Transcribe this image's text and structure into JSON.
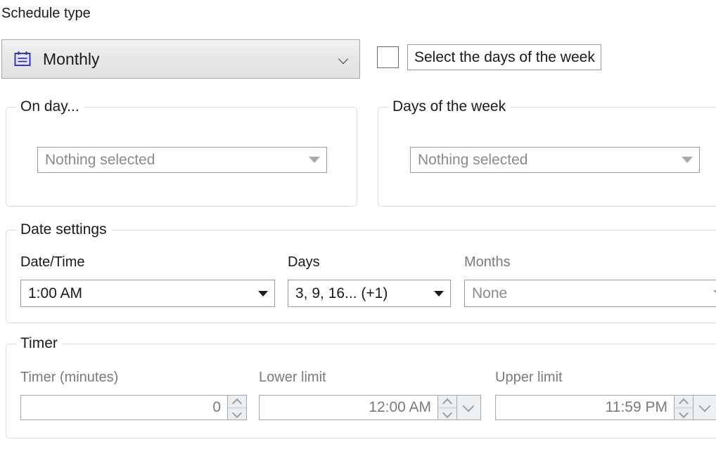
{
  "schedule_type": {
    "label": "Schedule type",
    "icon": "calendar-icon",
    "value": "Monthly",
    "chevron": "chevron-down-icon"
  },
  "weekdays_toggle": {
    "checked": false,
    "label": "Select the days of the week"
  },
  "on_day_group": {
    "title": "On day...",
    "dropdown": {
      "value": "Nothing selected",
      "enabled": false,
      "arrow": "triangle-down-icon"
    }
  },
  "days_of_week_group": {
    "title": "Days of the week",
    "dropdown": {
      "value": "Nothing selected",
      "enabled": false,
      "arrow": "triangle-down-icon"
    }
  },
  "date_settings": {
    "title": "Date settings",
    "fields": {
      "date_time": {
        "label": "Date/Time",
        "value": "1:00 AM",
        "enabled": true,
        "arrow": "triangle-down-icon"
      },
      "days": {
        "label": "Days",
        "value": "3, 9, 16... (+1)",
        "enabled": true,
        "arrow": "triangle-down-icon"
      },
      "months": {
        "label": "Months",
        "value": "None",
        "enabled": false,
        "arrow": "triangle-down-icon"
      }
    }
  },
  "timer": {
    "title": "Timer",
    "fields": {
      "minutes": {
        "label": "Timer (minutes)",
        "value": "0",
        "enabled": false,
        "spinner": "spinner-up-down-icon"
      },
      "lower_limit": {
        "label": "Lower limit",
        "value": "12:00 AM",
        "enabled": false,
        "spinner": "spinner-up-down-icon",
        "dropdown_button": "chevron-down-icon"
      },
      "upper_limit": {
        "label": "Upper limit",
        "value": "11:59 PM",
        "enabled": false,
        "spinner": "spinner-up-down-icon",
        "dropdown_button": "chevron-down-icon"
      }
    }
  },
  "colors": {
    "icon_blue": "#2020e0",
    "group_border": "#d4dce4",
    "field_border": "#9a9a9a",
    "disabled_text": "#8a8a8a",
    "text": "#1a1a1a"
  }
}
